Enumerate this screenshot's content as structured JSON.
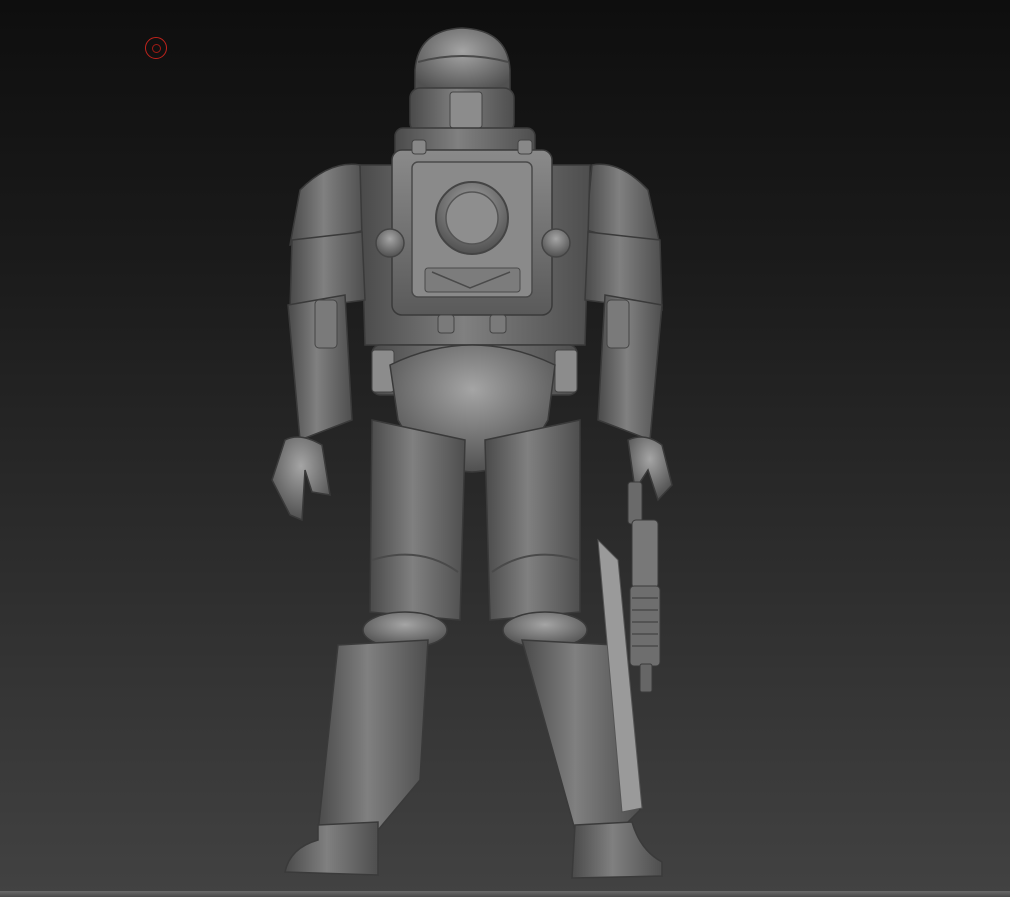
{
  "viewport": {
    "background_top": "#0e0e0e",
    "background_bottom": "#424242",
    "model_base_color": "#6e6e6e",
    "model_highlight_color": "#9a9a9a",
    "model_shadow_color": "#3a3a3a"
  },
  "cursor": {
    "icon": "brush-cursor-icon",
    "color": "#c0231c"
  },
  "model": {
    "subject": "armored-soldier-back-view-icon"
  }
}
